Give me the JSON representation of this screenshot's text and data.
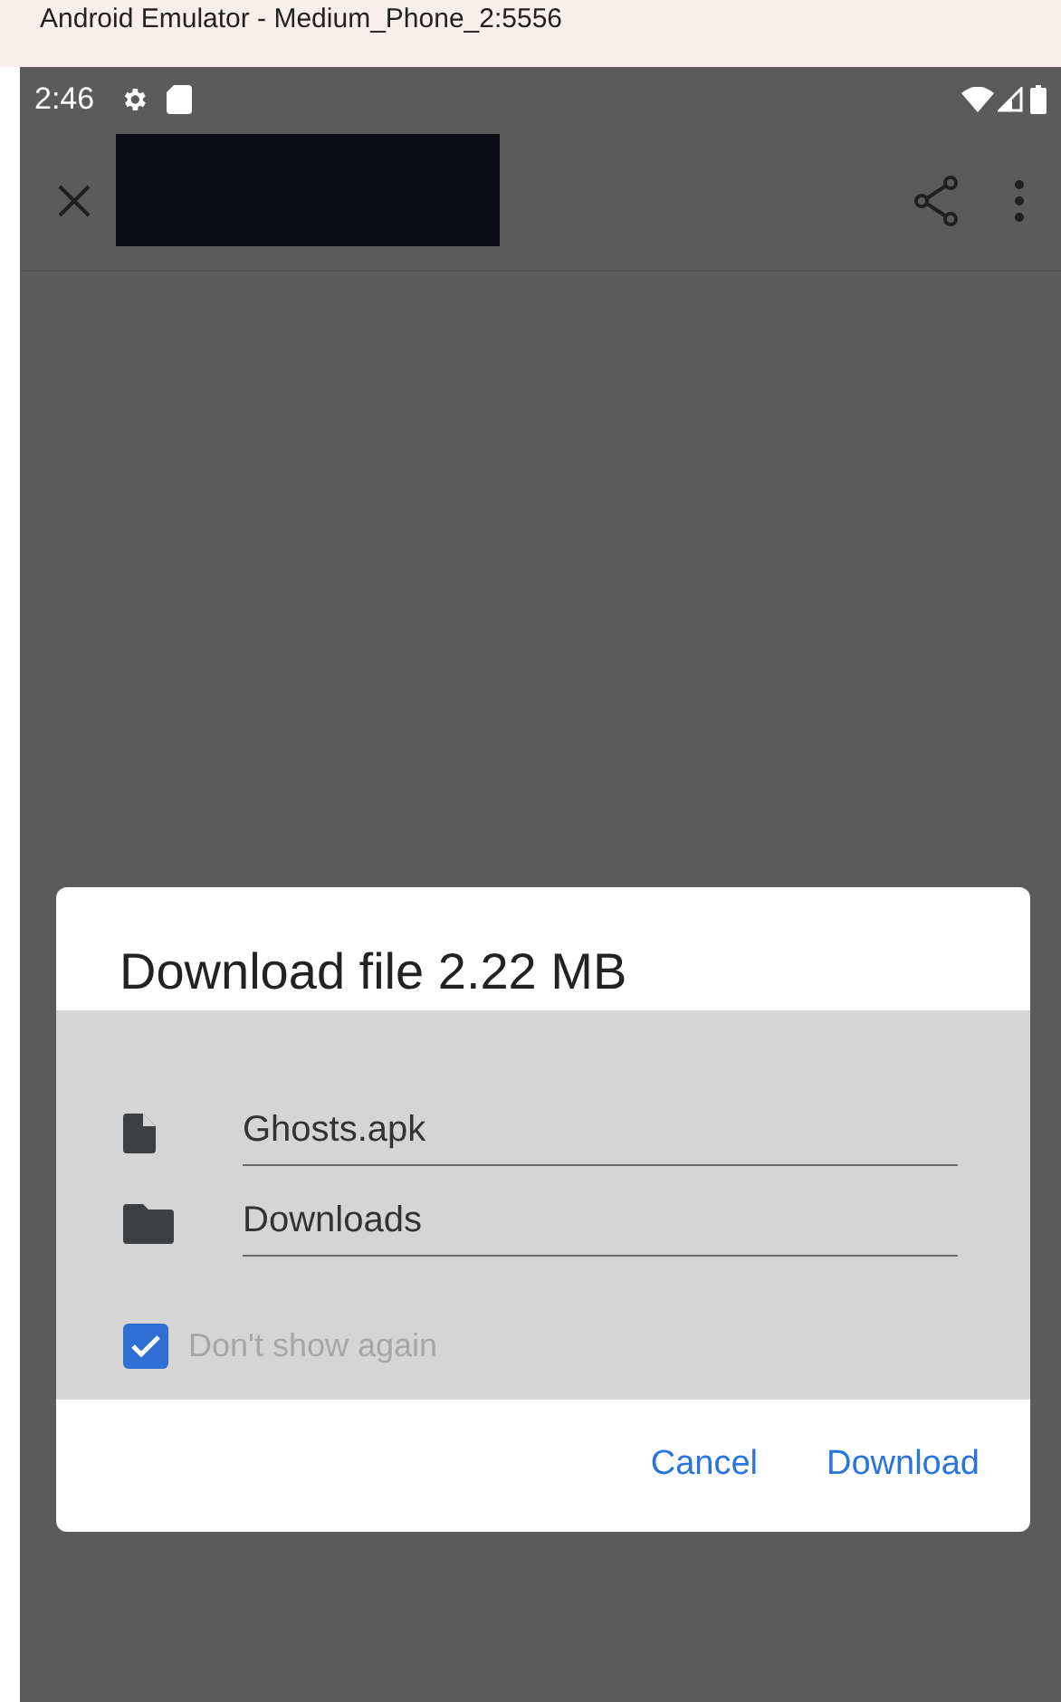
{
  "window": {
    "title": "Android Emulator - Medium_Phone_2:5556"
  },
  "status_bar": {
    "time": "2:46"
  },
  "dialog": {
    "title": "Download file 2.22 MB",
    "fields": [
      {
        "kind": "file",
        "value": "Ghosts.apk"
      },
      {
        "kind": "folder",
        "value": "Downloads"
      }
    ],
    "checkbox": {
      "label": "Don't show again",
      "checked": true
    },
    "buttons": [
      "Cancel",
      "Download"
    ]
  }
}
